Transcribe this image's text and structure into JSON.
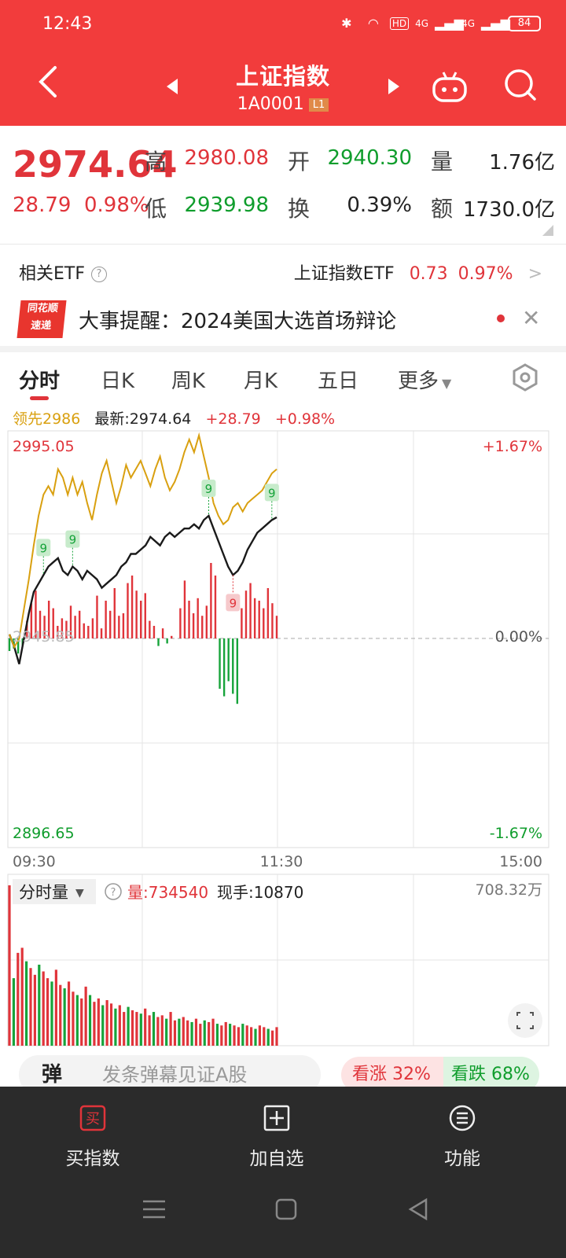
{
  "status_bar": {
    "time": "12:43",
    "hd": "HD",
    "net1": "4G",
    "net2": "4G",
    "battery": "84"
  },
  "header": {
    "title": "上证指数",
    "code": "1A0001",
    "level_badge": "L1"
  },
  "quote": {
    "price": "2974.64",
    "change": "28.79",
    "change_pct": "0.98%",
    "high_label": "高",
    "high": "2980.08",
    "open_label": "开",
    "open": "2940.30",
    "volume_label": "量",
    "volume": "1.76亿",
    "low_label": "低",
    "low": "2939.98",
    "turnover_label": "换",
    "turnover": "0.39%",
    "amount_label": "额",
    "amount": "1730.0亿"
  },
  "etf": {
    "label": "相关ETF",
    "name": "上证指数ETF",
    "price": "0.73",
    "pct": "0.97%"
  },
  "news": {
    "logo_top": "同花顺",
    "logo_bottom": "速递",
    "text": "大事提醒：2024美国大选首场辩论"
  },
  "tabs": [
    "分时",
    "日K",
    "周K",
    "月K",
    "五日",
    "更多"
  ],
  "legend": {
    "lead": "领先2986",
    "latest": "最新:2974.64",
    "chg": "+28.79",
    "pct": "+0.98%"
  },
  "chart_data": {
    "type": "line",
    "title": "",
    "xlabel": "",
    "ylabel": "",
    "x_tick_labels": [
      "09:30",
      "11:30",
      "15:00"
    ],
    "y_top_label": "2995.05",
    "y_mid_label": "2945.85",
    "y_bottom_label": "2896.65",
    "pct_top_label": "+1.67%",
    "pct_mid_label": "0.00%",
    "pct_bottom_label": "-1.67%",
    "ylim": [
      2896.65,
      2995.05
    ],
    "signal_marker": "9",
    "series": [
      {
        "name": "最新",
        "values": [
          2947,
          2944,
          2939.98,
          2946,
          2952,
          2957,
          2959,
          2961,
          2963,
          2964,
          2965,
          2962,
          2961,
          2963,
          2962,
          2960,
          2962,
          2961,
          2960,
          2958,
          2959,
          2960,
          2961,
          2963,
          2964,
          2966,
          2966,
          2967,
          2968,
          2970,
          2969,
          2968,
          2970,
          2971,
          2970,
          2971,
          2972,
          2972,
          2973,
          2972,
          2974,
          2975,
          2972,
          2969,
          2966,
          2963,
          2961,
          2962,
          2964,
          2967,
          2969,
          2971,
          2972,
          2973,
          2974,
          2974.64
        ]
      },
      {
        "name": "领先",
        "values": [
          2947,
          2944,
          2946,
          2953,
          2960,
          2968,
          2975,
          2980,
          2982,
          2980,
          2986,
          2984,
          2980,
          2984,
          2980,
          2983,
          2978,
          2974,
          2980,
          2985,
          2988,
          2983,
          2978,
          2982,
          2987,
          2984,
          2986,
          2988,
          2985,
          2982,
          2986,
          2989,
          2984,
          2981,
          2983,
          2986,
          2990,
          2993,
          2990,
          2994,
          2989,
          2984,
          2978,
          2975,
          2973,
          2974,
          2977,
          2978,
          2976,
          2978,
          2979,
          2980,
          2981,
          2983,
          2985,
          2986
        ]
      }
    ],
    "marker_indices": [
      7,
      13,
      41,
      46,
      54
    ],
    "macd_values": [
      -10,
      -8,
      -12,
      -6,
      14,
      28,
      38,
      22,
      18,
      30,
      24,
      10,
      16,
      14,
      26,
      18,
      22,
      12,
      10,
      16,
      34,
      8,
      30,
      22,
      40,
      18,
      20,
      44,
      50,
      38,
      30,
      36,
      14,
      10,
      -6,
      8,
      -4,
      2,
      0,
      24,
      46,
      30,
      20,
      32,
      18,
      26,
      60,
      50,
      -40,
      -46,
      -34,
      -44,
      -52,
      24,
      38,
      44,
      32,
      30,
      24,
      40,
      28,
      18
    ],
    "volume_label": "分时量",
    "volume_info": "量:734540",
    "hand_info": "现手:10870",
    "volume_max_label": "708.32万",
    "volume_values": [
      95,
      40,
      55,
      58,
      50,
      46,
      42,
      48,
      44,
      40,
      38,
      45,
      36,
      34,
      38,
      32,
      30,
      28,
      35,
      30,
      26,
      28,
      24,
      27,
      25,
      22,
      24,
      20,
      23,
      21,
      20,
      19,
      22,
      18,
      20,
      17,
      18,
      16,
      20,
      15,
      16,
      17,
      15,
      14,
      16,
      13,
      15,
      14,
      16,
      13,
      12,
      14,
      13,
      12,
      11,
      13,
      12,
      11,
      10,
      12,
      11,
      10,
      9,
      11
    ]
  },
  "danmu": {
    "avatar": "弹",
    "placeholder": "发条弹幕见证A股",
    "up": "看涨 32%",
    "down": "看跌 68%"
  },
  "toolbar": {
    "buy": "买指数",
    "watch": "加自选",
    "func": "功能",
    "buy_icon_text": "买"
  }
}
